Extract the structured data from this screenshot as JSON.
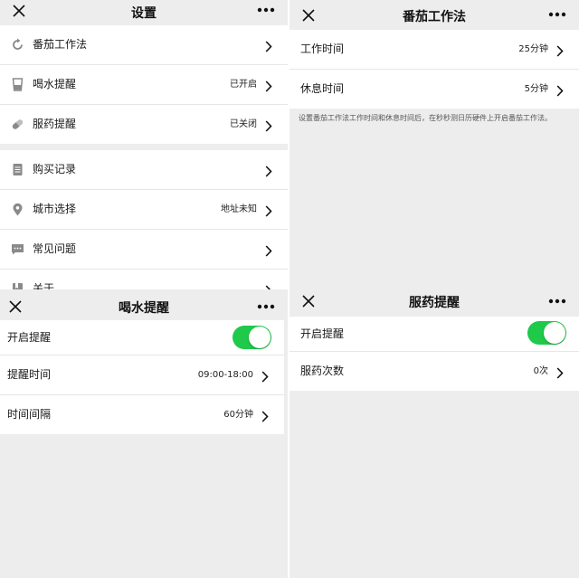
{
  "colors": {
    "toggle_on": "#1fc94a",
    "background": "#ededed",
    "row": "#ffffff",
    "icon": "#8a8a8a"
  },
  "settings": {
    "title": "设置",
    "group1": [
      {
        "label": "番茄工作法",
        "value": "",
        "icon": "refresh-icon"
      },
      {
        "label": "喝水提醒",
        "value": "已开启",
        "icon": "cup-icon"
      },
      {
        "label": "服药提醒",
        "value": "已关闭",
        "icon": "pill-icon"
      }
    ],
    "group2": [
      {
        "label": "购买记录",
        "value": "",
        "icon": "document-icon"
      },
      {
        "label": "城市选择",
        "value": "地址未知",
        "icon": "location-icon"
      },
      {
        "label": "常见问题",
        "value": "",
        "icon": "chat-icon"
      },
      {
        "label": "关于",
        "value": "",
        "icon": "book-icon"
      }
    ]
  },
  "pomodoro": {
    "title": "番茄工作法",
    "rows": [
      {
        "label": "工作时间",
        "value": "25分钟"
      },
      {
        "label": "休息时间",
        "value": "5分钟"
      }
    ],
    "note": "设置番茄工作法工作时间和休息时间后，在秒秒测日历硬件上开启番茄工作法。"
  },
  "water": {
    "title": "喝水提醒",
    "toggle_label": "开启提醒",
    "toggle_on": true,
    "rows": [
      {
        "label": "提醒时间",
        "value": "09:00-18:00"
      },
      {
        "label": "时间间隔",
        "value": "60分钟"
      }
    ]
  },
  "medicine": {
    "title": "服药提醒",
    "toggle_label": "开启提醒",
    "toggle_on": true,
    "rows": [
      {
        "label": "服药次数",
        "value": "0次"
      }
    ]
  }
}
